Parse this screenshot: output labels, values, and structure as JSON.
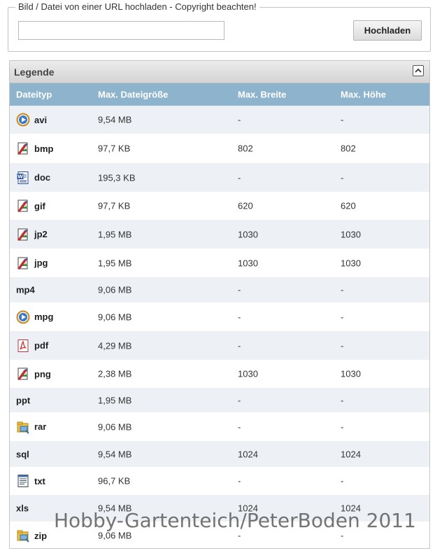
{
  "upload": {
    "legend": "Bild / Datei von einer URL hochladen - Copyright beachten!",
    "url_value": "",
    "button_label": "Hochladen"
  },
  "legend_panel": {
    "title": "Legende",
    "columns": [
      "Dateityp",
      "Max. Dateigröße",
      "Max. Breite",
      "Max. Höhe"
    ],
    "rows": [
      {
        "ext": "avi",
        "icon": "video-icon",
        "size": "9,54 MB",
        "width": "-",
        "height": "-"
      },
      {
        "ext": "bmp",
        "icon": "image-icon",
        "size": "97,7 KB",
        "width": "802",
        "height": "802"
      },
      {
        "ext": "doc",
        "icon": "word-icon",
        "size": "195,3 KB",
        "width": "-",
        "height": "-"
      },
      {
        "ext": "gif",
        "icon": "image-icon",
        "size": "97,7 KB",
        "width": "620",
        "height": "620"
      },
      {
        "ext": "jp2",
        "icon": "image-icon",
        "size": "1,95 MB",
        "width": "1030",
        "height": "1030"
      },
      {
        "ext": "jpg",
        "icon": "image-icon",
        "size": "1,95 MB",
        "width": "1030",
        "height": "1030"
      },
      {
        "ext": "mp4",
        "icon": "",
        "size": "9,06 MB",
        "width": "-",
        "height": "-"
      },
      {
        "ext": "mpg",
        "icon": "video-icon",
        "size": "9,06 MB",
        "width": "-",
        "height": "-"
      },
      {
        "ext": "pdf",
        "icon": "pdf-icon",
        "size": "4,29 MB",
        "width": "-",
        "height": "-"
      },
      {
        "ext": "png",
        "icon": "image-icon",
        "size": "2,38 MB",
        "width": "1030",
        "height": "1030"
      },
      {
        "ext": "ppt",
        "icon": "",
        "size": "1,95 MB",
        "width": "-",
        "height": "-"
      },
      {
        "ext": "rar",
        "icon": "archive-icon",
        "size": "9,06 MB",
        "width": "-",
        "height": "-"
      },
      {
        "ext": "sql",
        "icon": "",
        "size": "9,54 MB",
        "width": "1024",
        "height": "1024"
      },
      {
        "ext": "txt",
        "icon": "text-icon",
        "size": "96,7 KB",
        "width": "-",
        "height": "-"
      },
      {
        "ext": "xls",
        "icon": "",
        "size": "9,54 MB",
        "width": "1024",
        "height": "1024"
      },
      {
        "ext": "zip",
        "icon": "archive-icon",
        "size": "9,06 MB",
        "width": "-",
        "height": "-"
      }
    ]
  },
  "watermark": "Hobby-Gartenteich/PeterBoden 2011",
  "colors": {
    "column_header_bg": "#8eb3cd",
    "row_alt_bg": "#edf1f5",
    "panel_header_bg": "#dcdcdc"
  }
}
